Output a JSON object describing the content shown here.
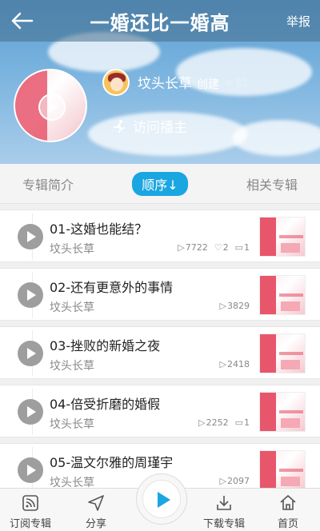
{
  "header": {
    "title": "一婚还比一婚高",
    "report_label": "举报"
  },
  "album": {
    "creator_name": "坟头长草",
    "creator_role": "创建",
    "creator_count": "81",
    "visit_label": "访问播主"
  },
  "tabs": [
    {
      "label": "专辑简介"
    },
    {
      "label": "顺序↓"
    },
    {
      "label": "相关专辑"
    }
  ],
  "tracks": [
    {
      "title": "01-这婚也能结？",
      "author": "坟头长草",
      "plays": "7722",
      "likes": "2",
      "comments": "1"
    },
    {
      "title": "02-还有更意外的事情",
      "author": "坟头长草",
      "plays": "3829"
    },
    {
      "title": "03-挫败的新婚之夜",
      "author": "坟头长草",
      "plays": "2418"
    },
    {
      "title": "04-倍受折磨的婚假",
      "author": "坟头长草",
      "plays": "2252",
      "comments": "1"
    },
    {
      "title": "05-温文尔雅的周瑾宇",
      "author": "坟头长草",
      "plays": "2097"
    }
  ],
  "bottom_nav": {
    "subscribe_label": "订阅专辑",
    "share_label": "分享",
    "download_label": "下载专辑",
    "home_label": "首页"
  },
  "colors": {
    "accent": "#1aa6e0",
    "cover_red": "#e8566c"
  }
}
